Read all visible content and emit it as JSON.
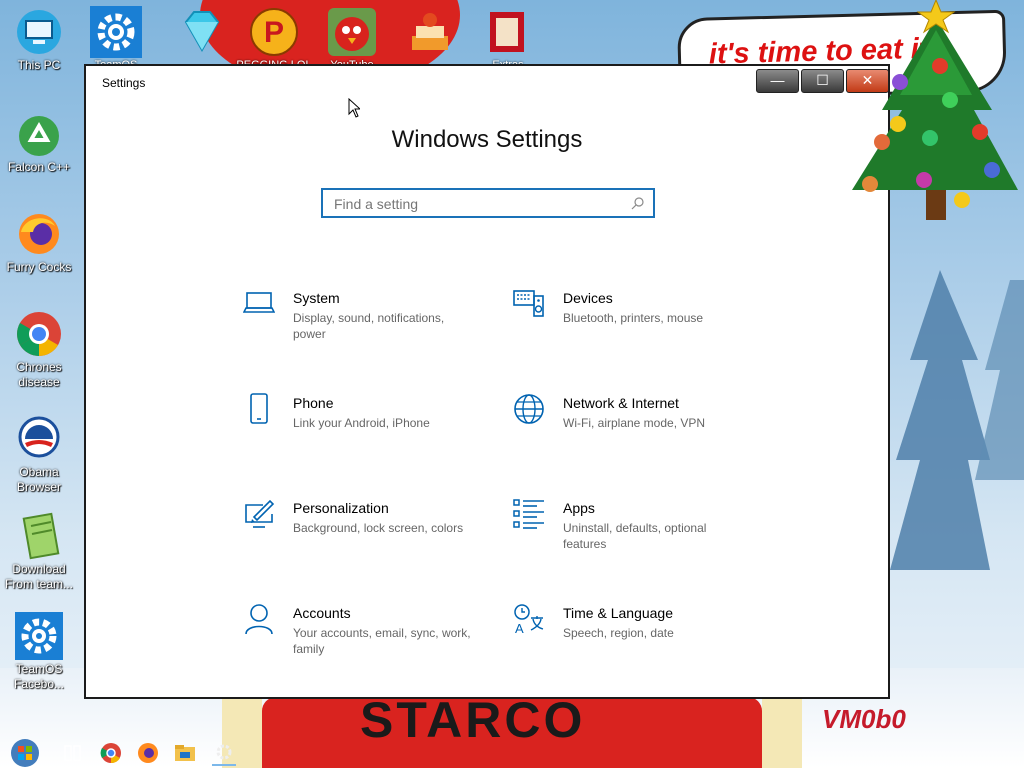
{
  "wallpaper": {
    "banner_text": "it's time to eat it",
    "starco_text": "STARCO",
    "signature": "VM0b0"
  },
  "desktop_icons": [
    {
      "name": "this-pc",
      "label": "This PC",
      "icon": "computer-icon"
    },
    {
      "name": "falcon",
      "label": "Falcon C++",
      "icon": "recycle-icon"
    },
    {
      "name": "furry-cocks",
      "label": "Furry Cocks",
      "icon": "firefox-icon"
    },
    {
      "name": "chrones",
      "label": "Chrones disease",
      "icon": "chrome-icon"
    },
    {
      "name": "obama",
      "label": "Obama Browser",
      "icon": "obama-logo-icon"
    },
    {
      "name": "download",
      "label": "Download From team...",
      "icon": "notepad-icon"
    },
    {
      "name": "teamos",
      "label": "TeamOS Facebo...",
      "icon": "gear-icon"
    }
  ],
  "top_icons": [
    {
      "name": "teamos-top",
      "label": "TeamOS",
      "icon": "gear-icon"
    },
    {
      "name": "gem",
      "label": "",
      "icon": "gem-icon"
    },
    {
      "name": "pegging",
      "label": "PEGGING LOL",
      "icon": "p-logo-icon"
    },
    {
      "name": "youtube",
      "label": "YouTube",
      "icon": "angry-bird-icon"
    },
    {
      "name": "cake",
      "label": "",
      "icon": "cake-icon"
    },
    {
      "name": "extras",
      "label": "Extras",
      "icon": "book-icon"
    }
  ],
  "window": {
    "title": "Settings",
    "heading": "Windows Settings",
    "search_placeholder": "Find a setting",
    "minimize": "—",
    "maximize": "☐",
    "close": "✕"
  },
  "tiles": [
    {
      "name": "system",
      "title": "System",
      "desc": "Display, sound, notifications, power",
      "icon": "laptop-icon"
    },
    {
      "name": "devices",
      "title": "Devices",
      "desc": "Bluetooth, printers, mouse",
      "icon": "keyboard-speaker-icon"
    },
    {
      "name": "phone",
      "title": "Phone",
      "desc": "Link your Android, iPhone",
      "icon": "phone-icon"
    },
    {
      "name": "network",
      "title": "Network & Internet",
      "desc": "Wi-Fi, airplane mode, VPN",
      "icon": "globe-icon"
    },
    {
      "name": "personalization",
      "title": "Personalization",
      "desc": "Background, lock screen, colors",
      "icon": "paint-monitor-icon"
    },
    {
      "name": "apps",
      "title": "Apps",
      "desc": "Uninstall, defaults, optional features",
      "icon": "apps-list-icon"
    },
    {
      "name": "accounts",
      "title": "Accounts",
      "desc": "Your accounts, email, sync, work, family",
      "icon": "person-icon"
    },
    {
      "name": "time-language",
      "title": "Time & Language",
      "desc": "Speech, region, date",
      "icon": "time-language-icon"
    }
  ],
  "taskbar": [
    "start-orb-icon",
    "task-view-icon",
    "chrome-icon",
    "firefox-icon",
    "file-explorer-icon",
    "settings-icon"
  ],
  "colors": {
    "accent": "#0063b1",
    "close": "#c23a16"
  }
}
